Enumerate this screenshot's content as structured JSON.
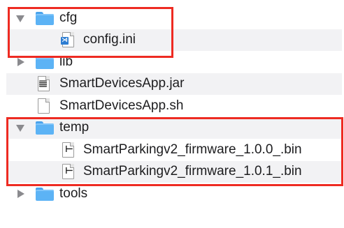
{
  "tree": [
    {
      "name": "cfg",
      "type": "folder",
      "expanded": true
    },
    {
      "name": "config.ini",
      "type": "file",
      "icon": "config-file-icon"
    },
    {
      "name": "lib",
      "type": "folder",
      "expanded": false
    },
    {
      "name": "SmartDevicesApp.jar",
      "type": "file",
      "icon": "jar-file-icon"
    },
    {
      "name": "SmartDevicesApp.sh",
      "type": "file",
      "icon": "document-icon"
    },
    {
      "name": "temp",
      "type": "folder",
      "expanded": true
    },
    {
      "name": "SmartParkingv2_firmware_1.0.0_.bin",
      "type": "file",
      "icon": "binary-file-icon"
    },
    {
      "name": "SmartParkingv2_firmware_1.0.1_.bin",
      "type": "file",
      "icon": "binary-file-icon"
    },
    {
      "name": "tools",
      "type": "folder",
      "expanded": false
    }
  ],
  "colors": {
    "highlight": "#ee2b22",
    "folder": "#5cb3f5",
    "alt_row": "#f2f2f4"
  }
}
